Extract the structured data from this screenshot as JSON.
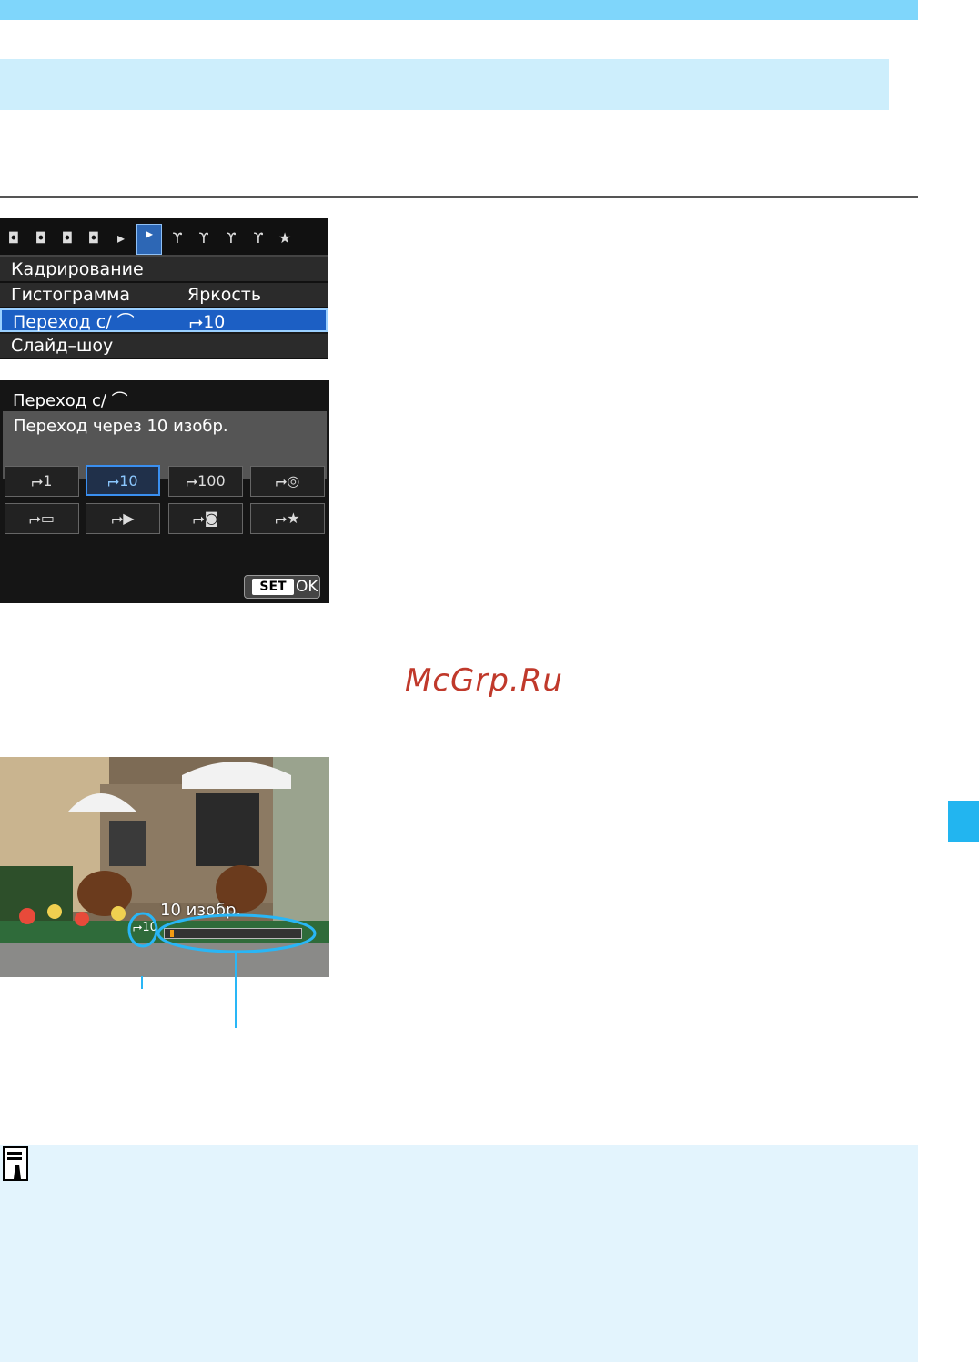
{
  "menu": {
    "tab_icons": [
      "camera-tab-1",
      "camera-tab-2",
      "camera-tab-3",
      "camera-tab-4",
      "playback-tab-1",
      "playback-tab-2",
      "setup-tab-1",
      "setup-tab-2",
      "setup-tab-3",
      "setup-tab-4",
      "mymenu-tab"
    ],
    "items": [
      {
        "label": "Кадрирование",
        "value": ""
      },
      {
        "label": "Гистограмма",
        "value": "Яркость"
      },
      {
        "label": "Переход с/ ⌒",
        "value": "⮣10"
      },
      {
        "label": "Слайд–шоу",
        "value": ""
      }
    ],
    "selected_index": 2
  },
  "submenu": {
    "title": "Переход с/ ⌒",
    "description": "Переход через 10 изобр.",
    "options_row1": [
      "⮣1",
      "⮣10",
      "⮣100",
      "⮣◎"
    ],
    "options_row2": [
      "⮣▭",
      "⮣▶",
      "⮣◙",
      "⮣★"
    ],
    "selected_option": "⮣10",
    "set_label": "SET",
    "ok_label": "OK"
  },
  "watermark": "McGrp.Ru",
  "photo": {
    "caption": "10 изобр.",
    "jump_icon": "⮣10"
  },
  "colors": {
    "accent": "#29b6f6",
    "header_band": "#cdeefc",
    "note_background": "#e3f4fd"
  }
}
